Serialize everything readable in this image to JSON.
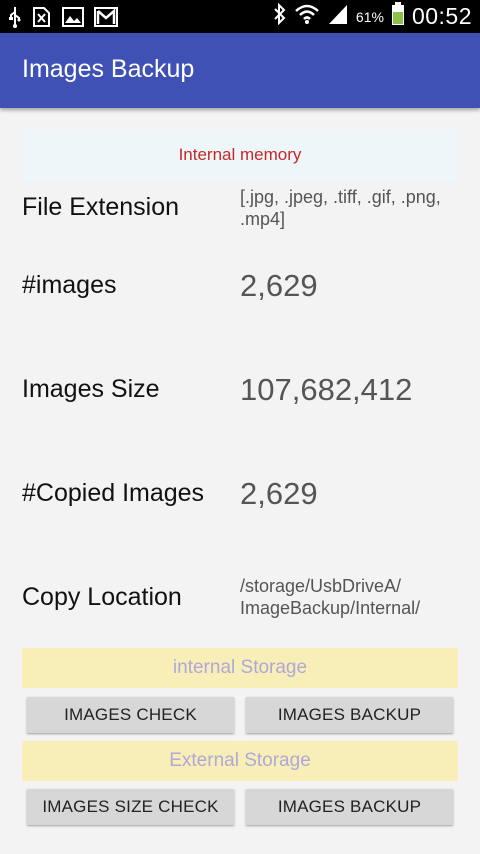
{
  "status_bar": {
    "battery_percent": "61%",
    "time": "00:52",
    "icons": [
      "usb-icon",
      "sim-blocked-icon",
      "image-icon",
      "gmail-icon",
      "bluetooth-icon",
      "wifi-icon",
      "signal-icon",
      "battery-icon"
    ],
    "battery_color": "#8bc34a"
  },
  "app_bar": {
    "title": "Images Backup",
    "color": "#3f51b5"
  },
  "storage_banner": {
    "label": "Internal memory"
  },
  "rows": {
    "file_extension": {
      "label": "File Extension",
      "value_line1": "[.jpg, .jpeg, .tiff, .gif, .png,",
      "value_line2": ".mp4]"
    },
    "images": {
      "label": "#images",
      "value": "2,629"
    },
    "images_size": {
      "label": "Images Size",
      "value": "107,682,412"
    },
    "copied_images": {
      "label": "#Copied Images",
      "value": "2,629"
    },
    "copy_location": {
      "label": "Copy Location",
      "value_line1": "/storage/UsbDriveA/",
      "value_line2": "ImageBackup/Internal/"
    }
  },
  "internal_section": {
    "title": "internal Storage",
    "check_button": "IMAGES CHECK",
    "backup_button": "IMAGES BACKUP"
  },
  "external_section": {
    "title": "External Storage",
    "check_button": "IMAGES SIZE CHECK",
    "backup_button": "IMAGES BACKUP"
  }
}
